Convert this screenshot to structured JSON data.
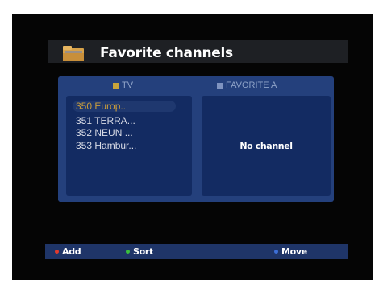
{
  "header": {
    "title": "Favorite channels",
    "icon": "folder-icon"
  },
  "columns": {
    "tv_label": "TV",
    "favorite_label": "FAVORITE A"
  },
  "channels": [
    {
      "label": "350 Europ..",
      "selected": true
    },
    {
      "label": "351  TERRA...",
      "selected": false
    },
    {
      "label": "352  NEUN ...",
      "selected": false
    },
    {
      "label": "353  Hambur...",
      "selected": false
    }
  ],
  "favorite_panel": {
    "empty_text": "No channel"
  },
  "footer": {
    "add_label": "Add",
    "add_color": "#e23b2e",
    "sort_label": "Sort",
    "sort_color": "#3bbf3e",
    "move_label": "Move",
    "move_color": "#3d6fd6"
  },
  "colors": {
    "panel": "#24407c",
    "list_bg": "#132b62",
    "selected_text": "#c89c3c"
  }
}
